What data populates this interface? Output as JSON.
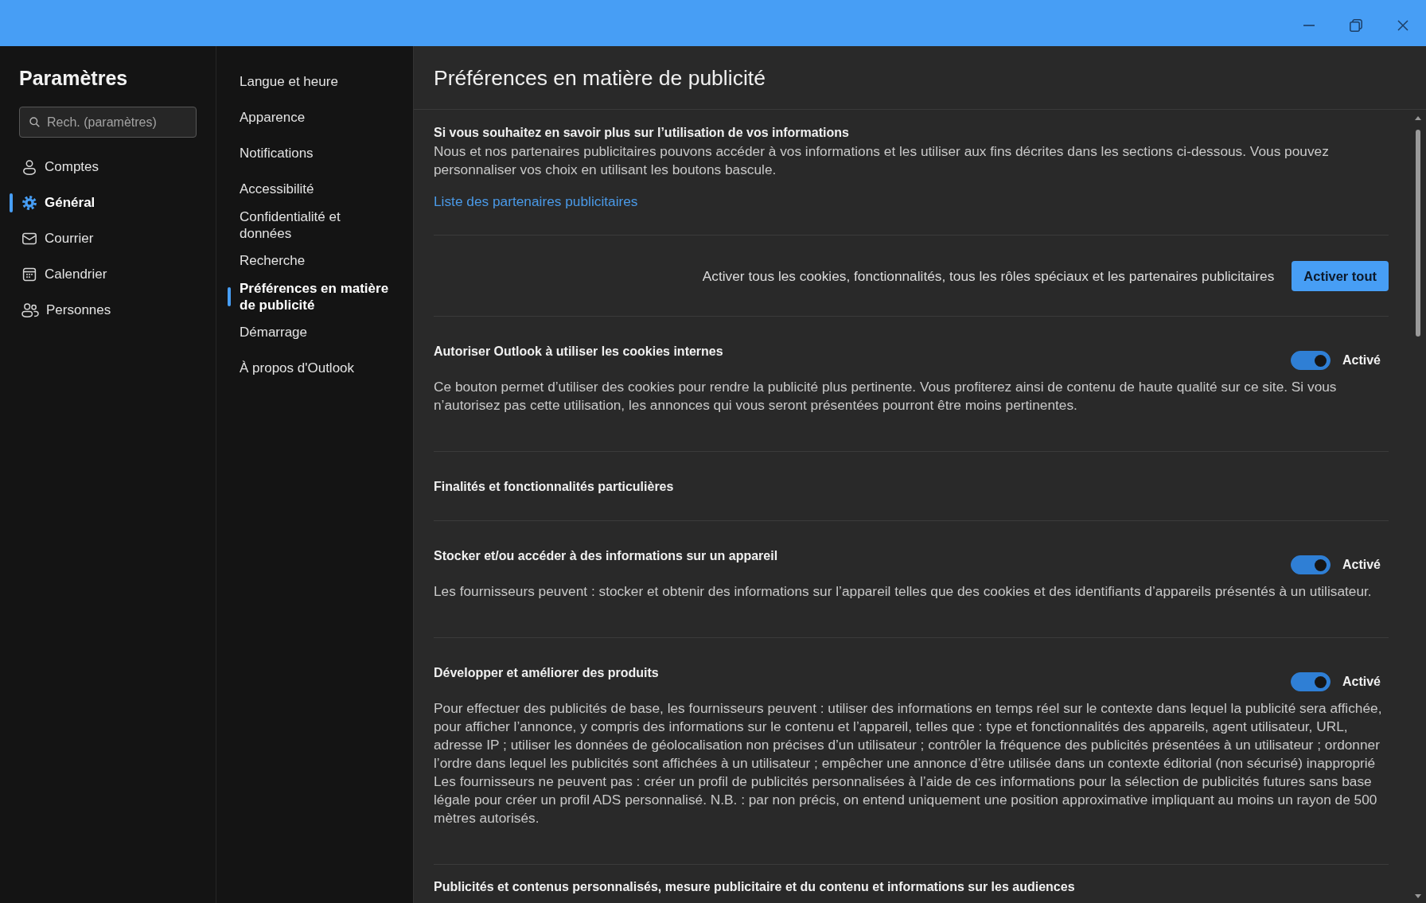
{
  "sidebar": {
    "title": "Paramètres",
    "search": {
      "placeholder": "Rech. (paramètres)"
    },
    "items": [
      {
        "label": "Comptes",
        "selected": false
      },
      {
        "label": "Général",
        "selected": true
      },
      {
        "label": "Courrier",
        "selected": false
      },
      {
        "label": "Calendrier",
        "selected": false
      },
      {
        "label": "Personnes",
        "selected": false
      }
    ]
  },
  "subnav": {
    "items": [
      {
        "label": "Langue et heure",
        "selected": false
      },
      {
        "label": "Apparence",
        "selected": false
      },
      {
        "label": "Notifications",
        "selected": false
      },
      {
        "label": "Accessibilité",
        "selected": false
      },
      {
        "label": "Confidentialité et données",
        "selected": false
      },
      {
        "label": "Recherche",
        "selected": false
      },
      {
        "label": "Préférences en matière de publicité",
        "selected": true
      },
      {
        "label": "Démarrage",
        "selected": false
      },
      {
        "label": "À propos d'Outlook",
        "selected": false
      }
    ]
  },
  "content": {
    "title": "Préférences en matière de publicité",
    "sections": [
      {
        "kind": "intro",
        "heading": "Si vous souhaitez en savoir plus sur l’utilisation de vos informations",
        "text": "Nous et nos partenaires publicitaires pouvons accéder à vos informations et les utiliser aux fins décrites dans les sections ci-dessous. Vous pouvez personnaliser vos choix en utilisant les boutons bascule.",
        "link": "Liste des partenaires publicitaires"
      },
      {
        "kind": "action",
        "text": "Activer tous les cookies, fonctionnalités, tous les rôles spéciaux et les partenaires publicitaires",
        "button": "Activer tout"
      },
      {
        "kind": "toggle",
        "heading": "Autoriser Outlook à utiliser les cookies internes",
        "on": true,
        "state_label": "Activé",
        "text": "Ce bouton permet d’utiliser des cookies pour rendre la publicité plus pertinente. Vous profiterez ainsi de contenu de haute qualité sur ce site. Si vous n’autorisez pas cette utilisation, les annonces qui vous seront présentées pourront être moins pertinentes."
      },
      {
        "kind": "heading",
        "heading": "Finalités et fonctionnalités particulières"
      },
      {
        "kind": "toggle",
        "heading": "Stocker et/ou accéder à des informations sur un appareil",
        "on": true,
        "state_label": "Activé",
        "text": "Les fournisseurs peuvent : stocker et obtenir des informations sur l’appareil telles que des cookies et des identifiants d’appareils présentés à un utilisateur."
      },
      {
        "kind": "toggle",
        "heading": "Développer et améliorer des produits",
        "on": true,
        "state_label": "Activé",
        "text": "Pour effectuer des publicités de base, les fournisseurs peuvent : utiliser des informations en temps réel sur le contexte dans lequel la publicité sera affichée, pour afficher l’annonce, y compris des informations sur le contenu et l’appareil, telles que : type et fonctionnalités des appareils, agent utilisateur, URL, adresse IP ; utiliser les données de géolocalisation non précises d’un utilisateur ; contrôler la fréquence des publicités présentées à un utilisateur ; ordonner l’ordre dans lequel les publicités sont affichées à un utilisateur ; empêcher une annonce d’être utilisée dans un contexte éditorial (non sécurisé) inapproprié Les fournisseurs ne peuvent pas : créer un profil de publicités personnalisées à l’aide de ces informations pour la sélection de publicités futures sans base légale pour créer un profil ADS personnalisé. N.B. : par non précis, on entend uniquement une position approximative impliquant au moins un rayon de 500 mètres autorisés."
      },
      {
        "kind": "heading",
        "heading": "Publicités et contenus personnalisés, mesure publicitaire et du contenu et informations sur les audiences"
      }
    ]
  }
}
